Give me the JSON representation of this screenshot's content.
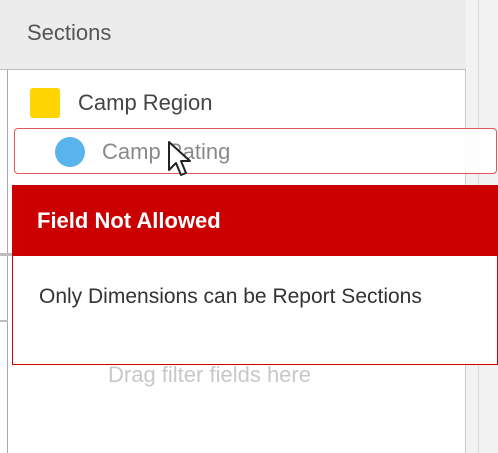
{
  "panel": {
    "title": "Sections"
  },
  "fields": {
    "region": {
      "label": "Camp Region",
      "color": "#ffd400",
      "icon": "square-swatch-icon"
    },
    "rating": {
      "label": "Camp Rating",
      "color": "#5ab4ec",
      "icon": "circle-swatch-icon"
    }
  },
  "filters": {
    "hint": "Drag filter fields here"
  },
  "toast": {
    "title": "Field Not Allowed",
    "message": "Only Dimensions can be Report Sections",
    "color": "#cc0000"
  },
  "cursor": {
    "icon": "mouse-pointer-icon"
  }
}
